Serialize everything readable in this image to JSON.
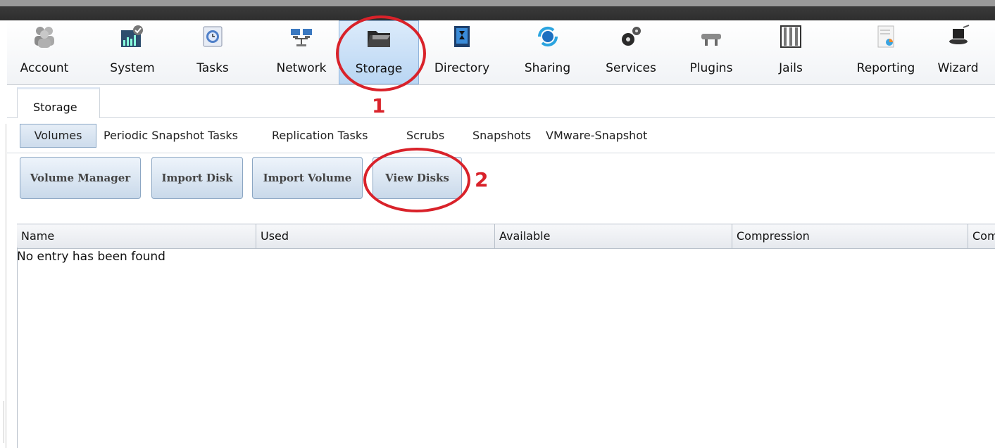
{
  "toolbar": {
    "items": [
      {
        "label": "Account",
        "icon": "users-icon"
      },
      {
        "label": "System",
        "icon": "system-chart-icon"
      },
      {
        "label": "Tasks",
        "icon": "calendar-clock-icon"
      },
      {
        "label": "Network",
        "icon": "network-computers-icon"
      },
      {
        "label": "Storage",
        "icon": "folder-icon"
      },
      {
        "label": "Directory",
        "icon": "book-icon"
      },
      {
        "label": "Sharing",
        "icon": "sharing-globe-icon"
      },
      {
        "label": "Services",
        "icon": "gears-icon"
      },
      {
        "label": "Plugins",
        "icon": "plug-icon"
      },
      {
        "label": "Jails",
        "icon": "jail-bars-icon"
      },
      {
        "label": "Reporting",
        "icon": "report-icon"
      },
      {
        "label": "Wizard",
        "icon": "wizard-hat-icon"
      }
    ],
    "active": "Storage"
  },
  "tab": {
    "label": "Storage"
  },
  "subtabs": [
    "Volumes",
    "Periodic Snapshot Tasks",
    "Replication Tasks",
    "Scrubs",
    "Snapshots",
    "VMware-Snapshot"
  ],
  "buttons": [
    "Volume Manager",
    "Import Disk",
    "Import Volume",
    "View Disks"
  ],
  "table": {
    "columns": [
      "Name",
      "Used",
      "Available",
      "Compression",
      "Com"
    ],
    "empty_message": "No entry has been found"
  },
  "annotations": {
    "marker_1": "1",
    "marker_2": "2",
    "color": "#d9222a"
  },
  "colors": {
    "accent": "#8fb3db",
    "highlight": "#d9222a"
  }
}
